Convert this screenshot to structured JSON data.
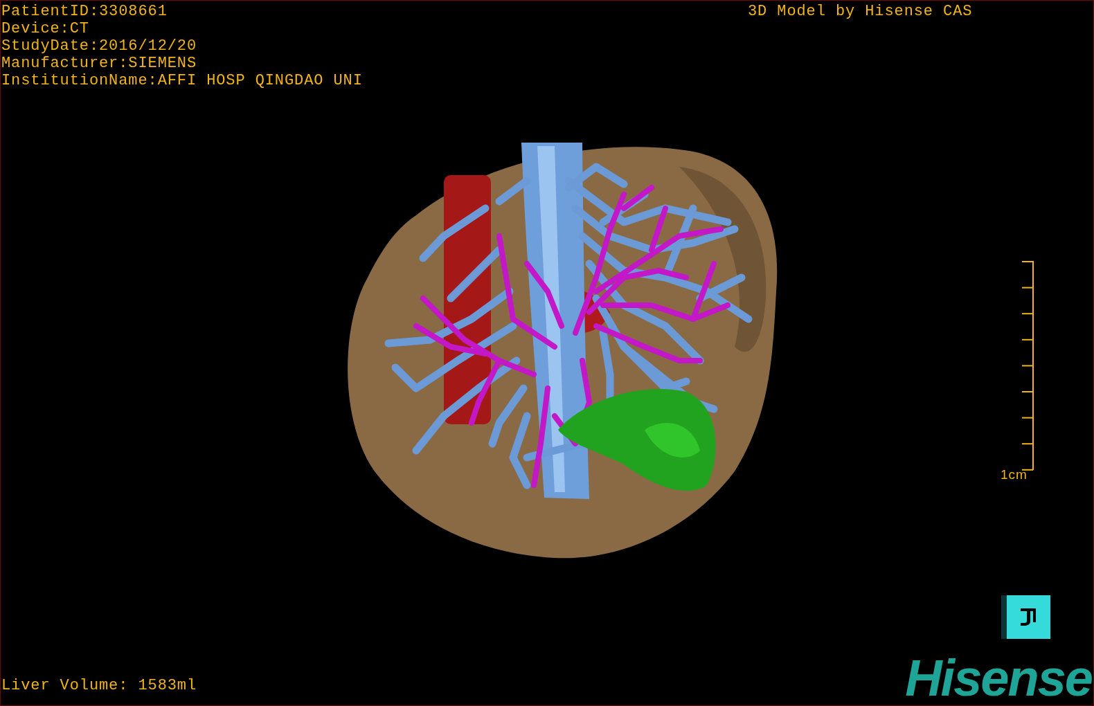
{
  "patient_info": [
    "PatientID:3308661",
    "Device:CT",
    "StudyDate:2016/12/20",
    "Manufacturer:SIEMENS",
    "InstitutionName:AFFI HOSP QINGDAO UNI"
  ],
  "header_right": "3D Model by Hisense CAS",
  "scale_bar": {
    "label": "1cm"
  },
  "liver_volume": "Liver Volume: 1583ml",
  "logo": {
    "text": "Hisense"
  }
}
